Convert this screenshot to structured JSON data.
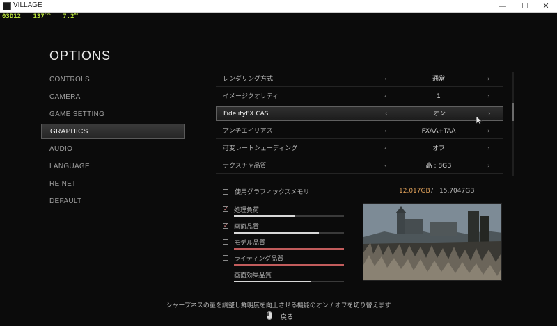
{
  "window": {
    "title": "VILLAGE",
    "minimize_glyph": "—",
    "maximize_glyph": "☐",
    "close_glyph": "✕"
  },
  "overlay": {
    "frame": "03D12",
    "fps": "137",
    "fps_unit": "FPS",
    "ms": "7.2",
    "ms_unit": "ms"
  },
  "menu": {
    "title": "OPTIONS",
    "items": [
      {
        "label": "CONTROLS"
      },
      {
        "label": "CAMERA"
      },
      {
        "label": "GAME SETTING"
      },
      {
        "label": "GRAPHICS"
      },
      {
        "label": "AUDIO"
      },
      {
        "label": "LANGUAGE"
      },
      {
        "label": "RE NET"
      },
      {
        "label": "DEFAULT"
      }
    ],
    "active_index": 3
  },
  "settings": {
    "rows": [
      {
        "label": "レンダリング方式",
        "value": "通常"
      },
      {
        "label": "イメージクオリティ",
        "value": "1"
      },
      {
        "label": "FidelityFX CAS",
        "value": "オン"
      },
      {
        "label": "アンチエイリアス",
        "value": "FXAA+TAA"
      },
      {
        "label": "可変レートシェーディング",
        "value": "オフ"
      },
      {
        "label": "テクスチャ品質",
        "value": "高 : 8GB"
      }
    ],
    "active_index": 2,
    "arrow_left": "‹",
    "arrow_right": "›"
  },
  "vram": {
    "label": "使用グラフィックスメモリ",
    "used": "12.017GB",
    "separator": "/",
    "total": "15.7047GB"
  },
  "load": {
    "items": [
      {
        "name": "処理負荷",
        "checked": true,
        "level": 0.55,
        "over": false
      },
      {
        "name": "画面品質",
        "checked": true,
        "level": 0.77,
        "over": false
      },
      {
        "name": "モデル品質",
        "checked": false,
        "level": 1.0,
        "over": true
      },
      {
        "name": "ライティング品質",
        "checked": false,
        "level": 1.0,
        "over": true
      },
      {
        "name": "画面効果品質",
        "checked": false,
        "level": 0.7,
        "over": false
      }
    ],
    "check_glyph": "✓"
  },
  "footer": {
    "description": "シャープネスの量を調整し鮮明度を向上させる機能のオン / オフを切り替えます",
    "back_label": "戻る"
  },
  "colors": {
    "vram_used": "#e0a15a",
    "overlay_text": "#b7e03a",
    "bar_fill": "#d8d8d8",
    "bar_over": "#c25c5c"
  }
}
